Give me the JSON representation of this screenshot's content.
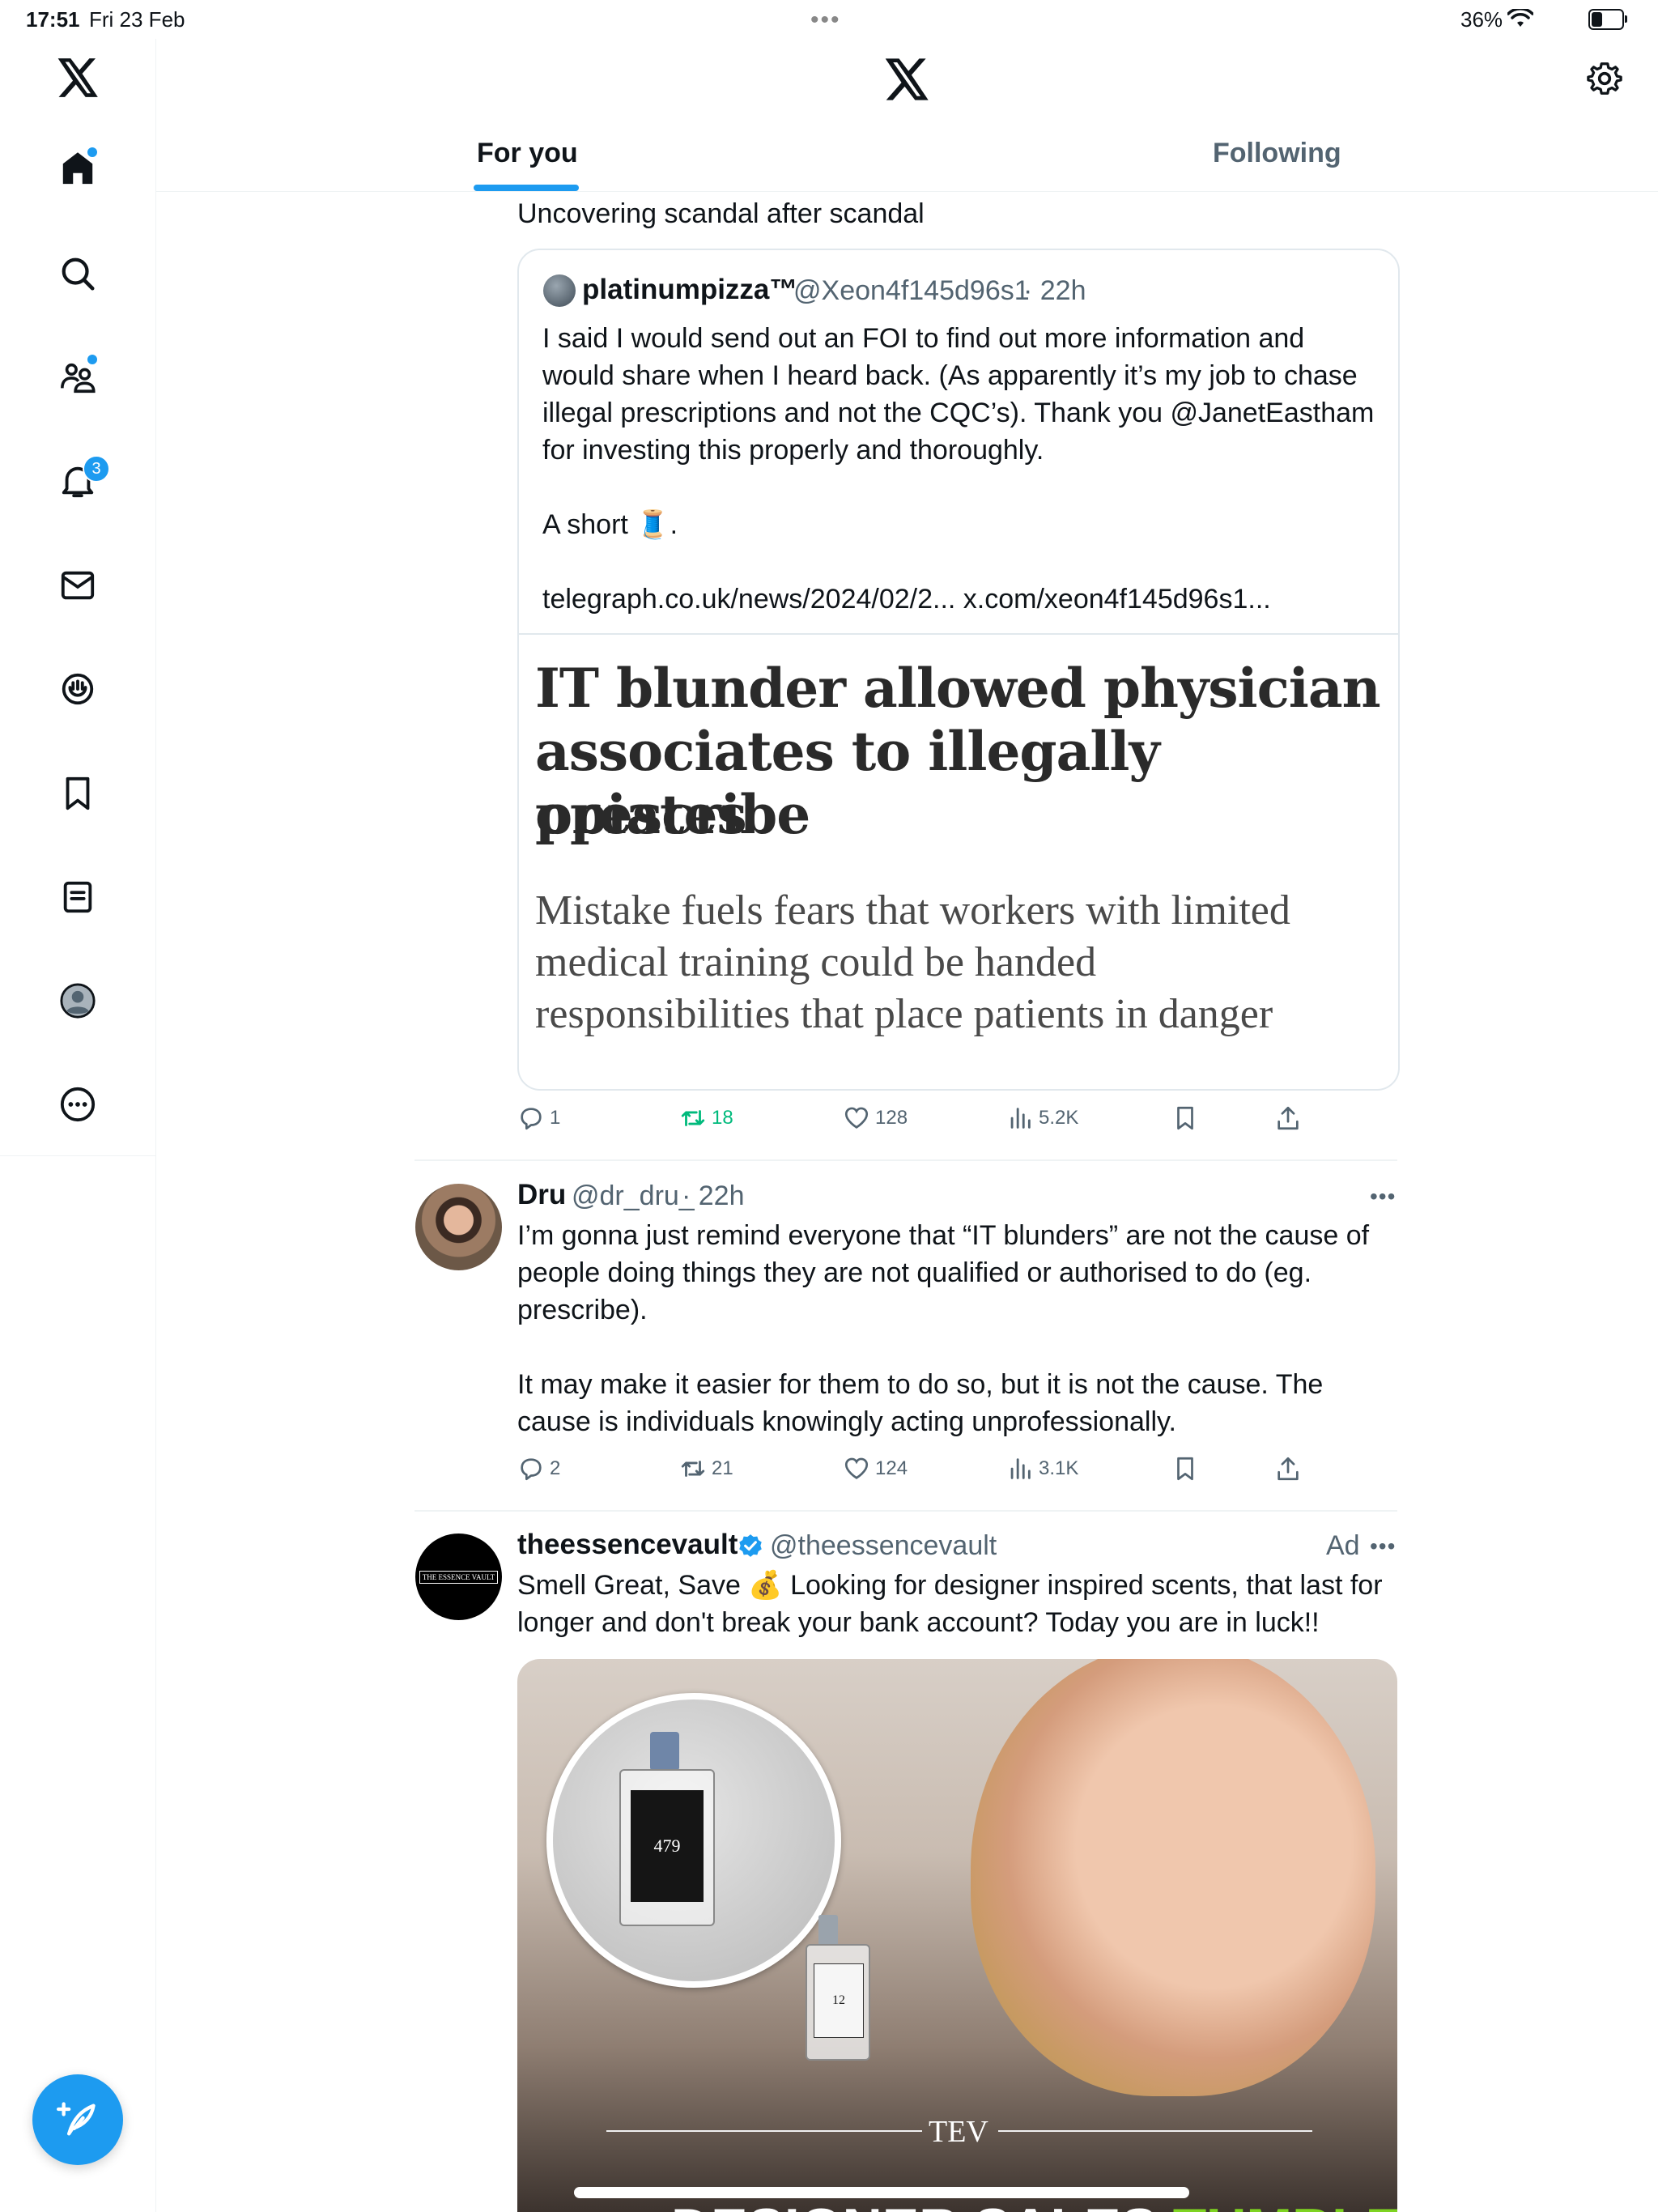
{
  "status_bar": {
    "time": "17:51",
    "date": "Fri 23 Feb",
    "battery_percent": "36%",
    "battery_level": 0.36
  },
  "sidebar": {
    "items": [
      {
        "name": "home",
        "icon": "home-icon",
        "has_dot": true
      },
      {
        "name": "explore",
        "icon": "search-icon"
      },
      {
        "name": "communities",
        "icon": "communities-icon",
        "has_dot": true
      },
      {
        "name": "notifications",
        "icon": "bell-icon",
        "badge": "3"
      },
      {
        "name": "messages",
        "icon": "mail-icon"
      },
      {
        "name": "grok",
        "icon": "grok-icon"
      },
      {
        "name": "bookmarks",
        "icon": "bookmark-icon"
      },
      {
        "name": "lists",
        "icon": "list-icon"
      },
      {
        "name": "profile",
        "icon": "profile-icon"
      },
      {
        "name": "more",
        "icon": "more-icon"
      }
    ],
    "compose_icon": "feather-plus-icon"
  },
  "header": {
    "tabs": [
      {
        "label": "For you",
        "active": true
      },
      {
        "label": "Following",
        "active": false
      }
    ]
  },
  "feed": {
    "post1": {
      "text_tail": "Uncovering scandal after scandal",
      "quote": {
        "name": "platinumpizza™",
        "handle": "@Xeon4f145d96s1",
        "time": "· 22h",
        "text_lines": [
          "I said I would send out an FOI to find out more information and",
          "would share when I heard back. (As apparently it’s my job to chase",
          "illegal prescriptions and not the CQC’s). Thank you @JanetEastham",
          "for investing this properly and thoroughly."
        ],
        "short": "A short",
        "short_emoji": "🧵",
        "short_end": ".",
        "links": "telegraph.co.uk/news/2024/02/2... x.com/xeon4f145d96s1...",
        "article_headline_lines": [
          "IT blunder allowed physician",
          "associates to illegally prescribe",
          "opiates"
        ],
        "article_sub_lines": [
          "Mistake fuels fears that workers with limited",
          "medical training could be handed",
          "responsibilities that place patients in danger"
        ]
      },
      "actions": {
        "replies": "1",
        "reposts": "18",
        "likes": "128",
        "views": "5.2K"
      }
    },
    "post2": {
      "name": "Dru",
      "handle": "@dr_dru_",
      "time": "· 22h",
      "text_lines": [
        "I’m gonna just remind everyone that “IT blunders” are not the cause of",
        "people doing things they are not qualified or authorised to do (eg.",
        "prescribe).",
        "",
        "It may make it easier for them to do so, but it is not the cause. The",
        "cause is individuals knowingly acting unprofessionally."
      ],
      "actions": {
        "replies": "2",
        "reposts": "21",
        "likes": "124",
        "views": "3.1K"
      }
    },
    "post3": {
      "name": "theessencevault",
      "handle": "@theessencevault",
      "ad_label": "Ad",
      "avatar_text": "THE ESSENCE VAULT",
      "text_lines": [
        "Smell Great, Save 💰 Looking for designer inspired scents, that last for",
        "longer and don't break your bank account? Today you are in luck!!"
      ],
      "image": {
        "bottle1_number": "479",
        "bottle2_number": "12",
        "brand_mark": "TEV",
        "banner_white": "DESIGNER SALES",
        "banner_green": "TUMBLE"
      }
    }
  },
  "colors": {
    "accent": "#1d9bf0",
    "repost_active": "#00ba7c",
    "muted": "#536471",
    "border": "#eff3f4"
  }
}
